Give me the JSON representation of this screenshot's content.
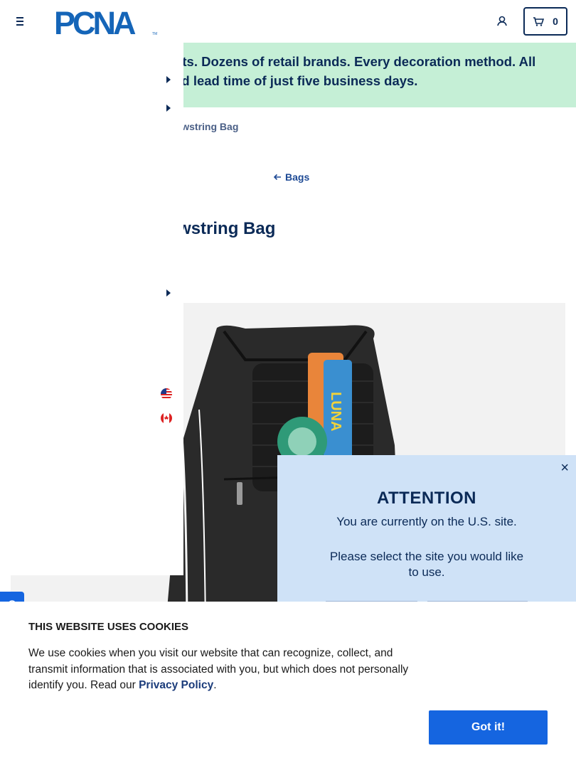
{
  "header": {
    "logo_text": "PCNA",
    "logo_tm": "TM",
    "cart_count": "0"
  },
  "promo": {
    "text": "roducts. Dozens of retail brands. Every decoration method. All\nandard lead time of just five business days."
  },
  "breadcrumb": {
    "current": "cket Drawstring Bag"
  },
  "back_link": {
    "label": "Bags"
  },
  "page_title": "Drawstring Bag",
  "product_image": {
    "brand_text": "LUNA",
    "alt": "Black drawstring bag with mesh pocket"
  },
  "attention": {
    "close_label": "×",
    "title": "ATTENTION",
    "message": "You are currently on the U.S. site.",
    "select_prompt": "Please select the site you would like to use."
  },
  "cookie": {
    "title": "THIS WEBSITE USES COOKIES",
    "text_before": "We use cookies when you visit our website that can recognize, collect, and transmit information that is associated with you, but which does not personally identify you. Read our ",
    "link": "Privacy Policy",
    "text_after": ".",
    "button": "Got it!"
  },
  "colors": {
    "navy": "#0b2a57",
    "promo_bg": "#c5efd6",
    "attention_bg": "#cfe2f7",
    "accent_blue": "#1565e0"
  },
  "icons": [
    "menu-icon",
    "account-icon",
    "cart-icon",
    "arrow-left-icon",
    "caret-right-icon",
    "us-flag-icon",
    "canada-flag-icon",
    "chat-icon",
    "close-icon"
  ]
}
